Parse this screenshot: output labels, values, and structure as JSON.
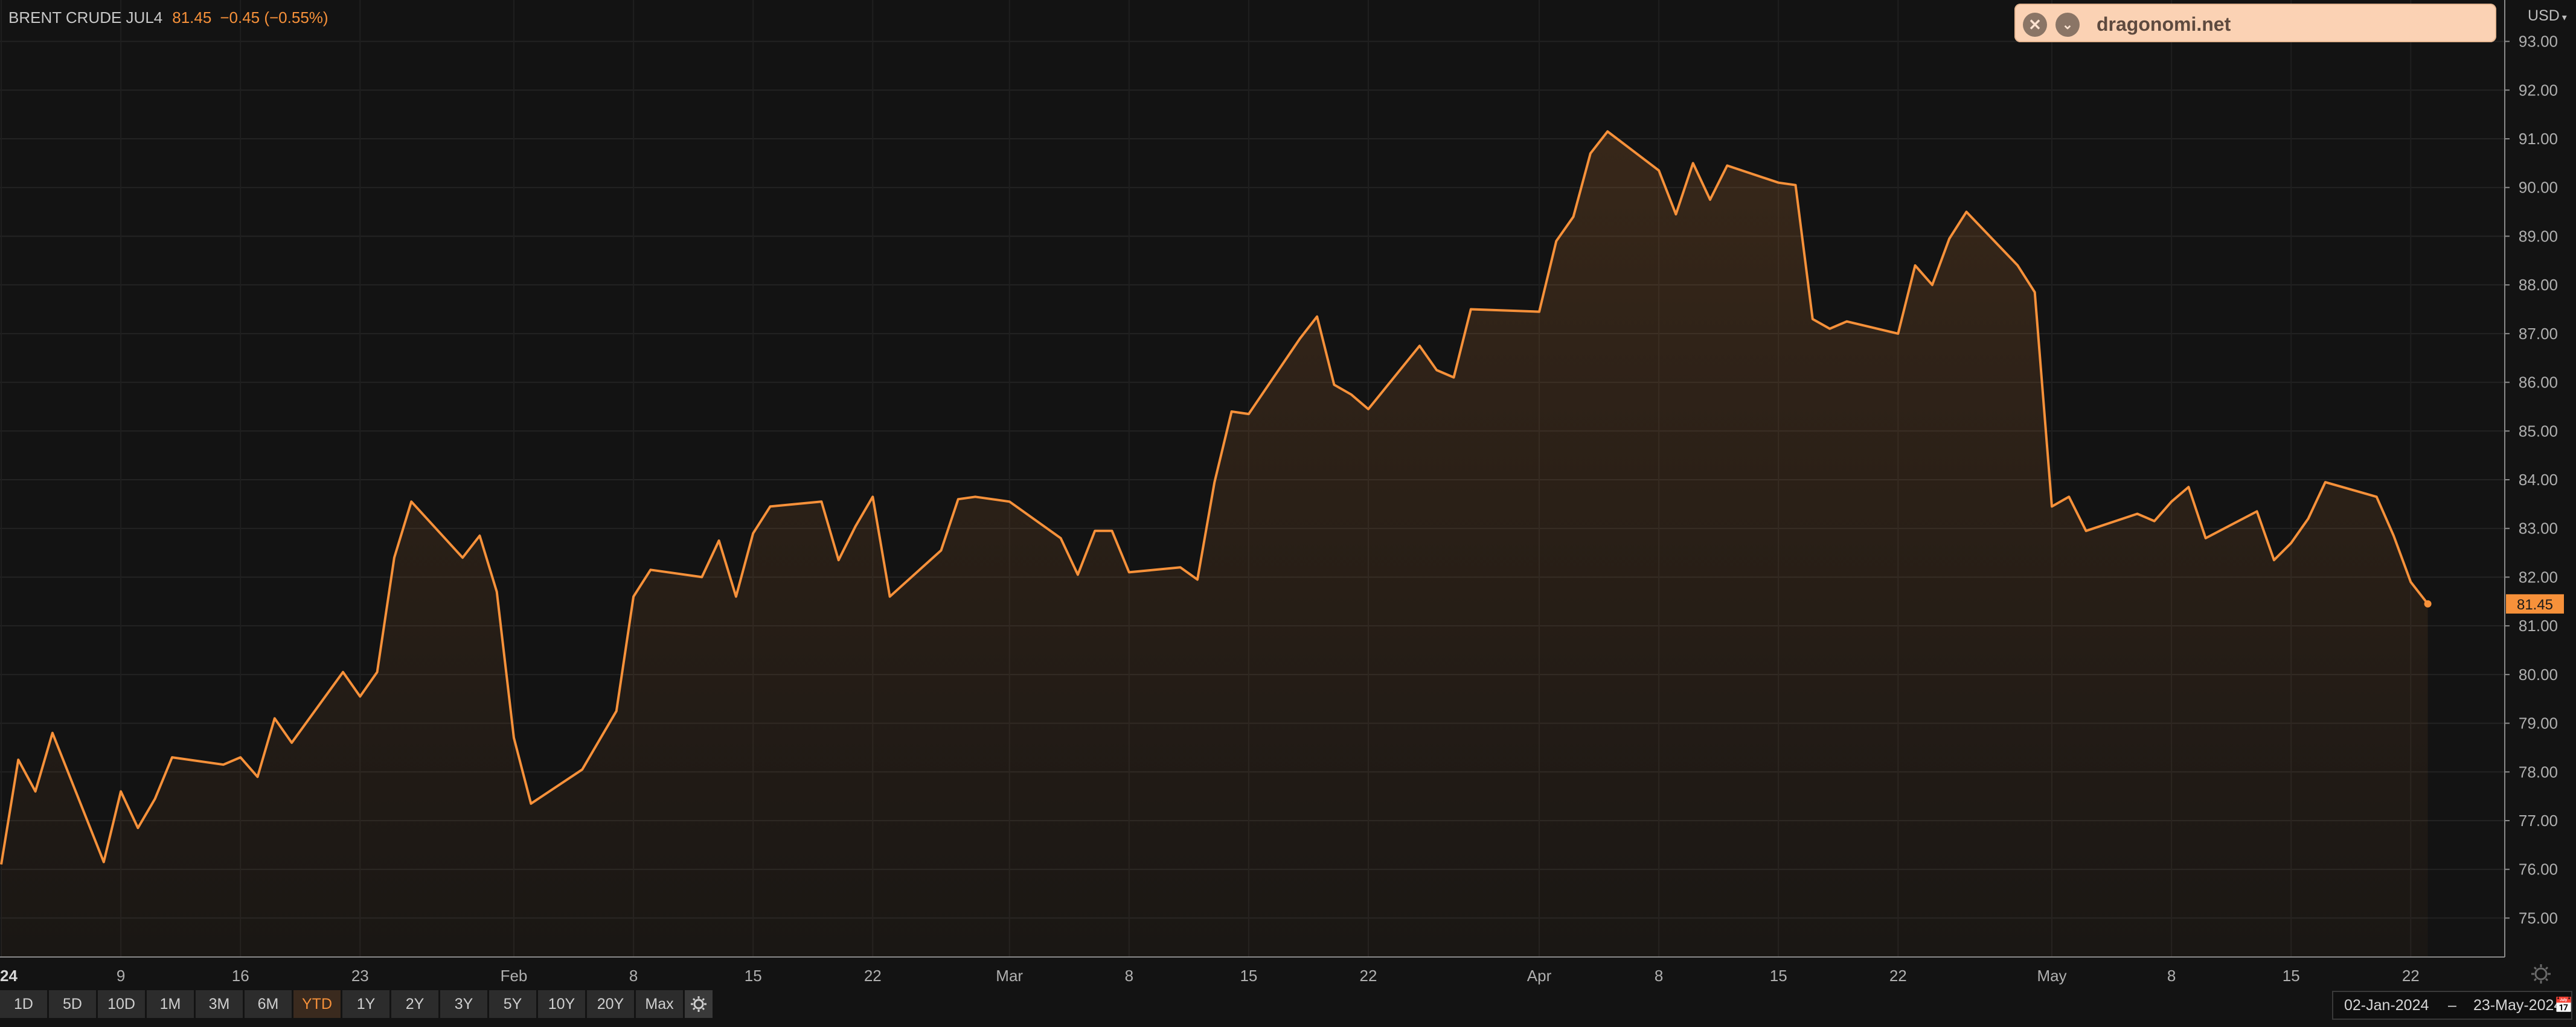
{
  "header": {
    "symbol": "BRENT CRUDE JUL4",
    "last": "81.45",
    "change": "−0.45 (−0.55%)"
  },
  "currency": {
    "label": "USD",
    "caret": "▾"
  },
  "overlay": {
    "site": "dragonomi.net",
    "close_glyph": "✕",
    "expand_glyph": "⌄"
  },
  "ranges": [
    "1D",
    "5D",
    "10D",
    "1M",
    "3M",
    "6M",
    "YTD",
    "1Y",
    "2Y",
    "3Y",
    "5Y",
    "10Y",
    "20Y",
    "Max"
  ],
  "active_range": "YTD",
  "date_range": {
    "from": "02-Jan-2024",
    "separator": "–",
    "to": "23-May-2024",
    "calendar_glyph": "📅"
  },
  "colors": {
    "accent": "#f7913a",
    "background": "#131313",
    "grid": "#222222",
    "axis_text": "#b0b0b0"
  },
  "chart_data": {
    "type": "area",
    "title": "BRENT CRUDE JUL4",
    "ylabel": "USD",
    "ylim": [
      74.2,
      93.85
    ],
    "y_ticks": [
      "93.00",
      "92.00",
      "91.00",
      "90.00",
      "89.00",
      "88.00",
      "87.00",
      "86.00",
      "85.00",
      "84.00",
      "83.00",
      "82.00",
      "81.00",
      "80.00",
      "79.00",
      "78.00",
      "77.00",
      "76.00",
      "75.00"
    ],
    "y_tick_values": [
      93,
      92,
      91,
      90,
      89,
      88,
      87,
      86,
      85,
      84,
      83,
      82,
      81,
      80,
      79,
      78,
      77,
      76,
      75
    ],
    "x_ticks": [
      {
        "label": "24",
        "date": "2024-01-02"
      },
      {
        "label": "9",
        "date": "2024-01-09"
      },
      {
        "label": "16",
        "date": "2024-01-16"
      },
      {
        "label": "23",
        "date": "2024-01-23"
      },
      {
        "label": "Feb",
        "date": "2024-02-01"
      },
      {
        "label": "8",
        "date": "2024-02-08"
      },
      {
        "label": "15",
        "date": "2024-02-15"
      },
      {
        "label": "22",
        "date": "2024-02-22"
      },
      {
        "label": "Mar",
        "date": "2024-03-01"
      },
      {
        "label": "8",
        "date": "2024-03-08"
      },
      {
        "label": "15",
        "date": "2024-03-15"
      },
      {
        "label": "22",
        "date": "2024-03-22"
      },
      {
        "label": "Apr",
        "date": "2024-04-01"
      },
      {
        "label": "8",
        "date": "2024-04-08"
      },
      {
        "label": "15",
        "date": "2024-04-15"
      },
      {
        "label": "22",
        "date": "2024-04-22"
      },
      {
        "label": "May",
        "date": "2024-05-01"
      },
      {
        "label": "8",
        "date": "2024-05-08"
      },
      {
        "label": "15",
        "date": "2024-05-15"
      },
      {
        "label": "22",
        "date": "2024-05-22"
      }
    ],
    "last_value_label": "81.45",
    "grid": true,
    "series": [
      {
        "values": [
          {
            "date": "2024-01-02",
            "value": 76.1
          },
          {
            "date": "2024-01-03",
            "value": 78.25
          },
          {
            "date": "2024-01-04",
            "value": 77.6
          },
          {
            "date": "2024-01-05",
            "value": 78.8
          },
          {
            "date": "2024-01-08",
            "value": 76.15
          },
          {
            "date": "2024-01-09",
            "value": 77.6
          },
          {
            "date": "2024-01-10",
            "value": 76.85
          },
          {
            "date": "2024-01-11",
            "value": 77.45
          },
          {
            "date": "2024-01-12",
            "value": 78.3
          },
          {
            "date": "2024-01-15",
            "value": 78.15
          },
          {
            "date": "2024-01-16",
            "value": 78.3
          },
          {
            "date": "2024-01-17",
            "value": 77.9
          },
          {
            "date": "2024-01-18",
            "value": 79.1
          },
          {
            "date": "2024-01-19",
            "value": 78.6
          },
          {
            "date": "2024-01-22",
            "value": 80.05
          },
          {
            "date": "2024-01-23",
            "value": 79.55
          },
          {
            "date": "2024-01-24",
            "value": 80.05
          },
          {
            "date": "2024-01-25",
            "value": 82.4
          },
          {
            "date": "2024-01-26",
            "value": 83.55
          },
          {
            "date": "2024-01-29",
            "value": 82.4
          },
          {
            "date": "2024-01-30",
            "value": 82.85
          },
          {
            "date": "2024-01-31",
            "value": 81.7
          },
          {
            "date": "2024-02-01",
            "value": 78.7
          },
          {
            "date": "2024-02-02",
            "value": 77.35
          },
          {
            "date": "2024-02-05",
            "value": 78.05
          },
          {
            "date": "2024-02-06",
            "value": 78.65
          },
          {
            "date": "2024-02-07",
            "value": 79.25
          },
          {
            "date": "2024-02-08",
            "value": 81.6
          },
          {
            "date": "2024-02-09",
            "value": 82.15
          },
          {
            "date": "2024-02-12",
            "value": 82.0
          },
          {
            "date": "2024-02-13",
            "value": 82.75
          },
          {
            "date": "2024-02-14",
            "value": 81.6
          },
          {
            "date": "2024-02-15",
            "value": 82.9
          },
          {
            "date": "2024-02-16",
            "value": 83.45
          },
          {
            "date": "2024-02-19",
            "value": 83.55
          },
          {
            "date": "2024-02-20",
            "value": 82.35
          },
          {
            "date": "2024-02-21",
            "value": 83.05
          },
          {
            "date": "2024-02-22",
            "value": 83.65
          },
          {
            "date": "2024-02-23",
            "value": 81.6
          },
          {
            "date": "2024-02-26",
            "value": 82.55
          },
          {
            "date": "2024-02-27",
            "value": 83.6
          },
          {
            "date": "2024-02-28",
            "value": 83.65
          },
          {
            "date": "2024-02-29",
            "value": 83.6
          },
          {
            "date": "2024-03-01",
            "value": 83.55
          },
          {
            "date": "2024-03-04",
            "value": 82.8
          },
          {
            "date": "2024-03-05",
            "value": 82.05
          },
          {
            "date": "2024-03-06",
            "value": 82.95
          },
          {
            "date": "2024-03-07",
            "value": 82.95
          },
          {
            "date": "2024-03-08",
            "value": 82.1
          },
          {
            "date": "2024-03-11",
            "value": 82.2
          },
          {
            "date": "2024-03-12",
            "value": 81.95
          },
          {
            "date": "2024-03-13",
            "value": 83.95
          },
          {
            "date": "2024-03-14",
            "value": 85.4
          },
          {
            "date": "2024-03-15",
            "value": 85.35
          },
          {
            "date": "2024-03-18",
            "value": 86.9
          },
          {
            "date": "2024-03-19",
            "value": 87.35
          },
          {
            "date": "2024-03-20",
            "value": 85.95
          },
          {
            "date": "2024-03-21",
            "value": 85.75
          },
          {
            "date": "2024-03-22",
            "value": 85.45
          },
          {
            "date": "2024-03-25",
            "value": 86.75
          },
          {
            "date": "2024-03-26",
            "value": 86.25
          },
          {
            "date": "2024-03-27",
            "value": 86.1
          },
          {
            "date": "2024-03-28",
            "value": 87.5
          },
          {
            "date": "2024-04-01",
            "value": 87.45
          },
          {
            "date": "2024-04-02",
            "value": 88.9
          },
          {
            "date": "2024-04-03",
            "value": 89.4
          },
          {
            "date": "2024-04-04",
            "value": 90.7
          },
          {
            "date": "2024-04-05",
            "value": 91.15
          },
          {
            "date": "2024-04-08",
            "value": 90.35
          },
          {
            "date": "2024-04-09",
            "value": 89.45
          },
          {
            "date": "2024-04-10",
            "value": 90.5
          },
          {
            "date": "2024-04-11",
            "value": 89.75
          },
          {
            "date": "2024-04-12",
            "value": 90.45
          },
          {
            "date": "2024-04-15",
            "value": 90.1
          },
          {
            "date": "2024-04-16",
            "value": 90.05
          },
          {
            "date": "2024-04-17",
            "value": 87.3
          },
          {
            "date": "2024-04-18",
            "value": 87.1
          },
          {
            "date": "2024-04-19",
            "value": 87.25
          },
          {
            "date": "2024-04-22",
            "value": 87.0
          },
          {
            "date": "2024-04-23",
            "value": 88.4
          },
          {
            "date": "2024-04-24",
            "value": 88.0
          },
          {
            "date": "2024-04-25",
            "value": 88.95
          },
          {
            "date": "2024-04-26",
            "value": 89.5
          },
          {
            "date": "2024-04-29",
            "value": 88.4
          },
          {
            "date": "2024-04-30",
            "value": 87.85
          },
          {
            "date": "2024-05-01",
            "value": 83.45
          },
          {
            "date": "2024-05-02",
            "value": 83.65
          },
          {
            "date": "2024-05-03",
            "value": 82.95
          },
          {
            "date": "2024-05-06",
            "value": 83.3
          },
          {
            "date": "2024-05-07",
            "value": 83.15
          },
          {
            "date": "2024-05-08",
            "value": 83.55
          },
          {
            "date": "2024-05-09",
            "value": 83.85
          },
          {
            "date": "2024-05-10",
            "value": 82.8
          },
          {
            "date": "2024-05-13",
            "value": 83.35
          },
          {
            "date": "2024-05-14",
            "value": 82.35
          },
          {
            "date": "2024-05-15",
            "value": 82.7
          },
          {
            "date": "2024-05-16",
            "value": 83.2
          },
          {
            "date": "2024-05-17",
            "value": 83.95
          },
          {
            "date": "2024-05-20",
            "value": 83.65
          },
          {
            "date": "2024-05-21",
            "value": 82.85
          },
          {
            "date": "2024-05-22",
            "value": 81.9
          },
          {
            "date": "2024-05-23",
            "value": 81.45
          }
        ]
      }
    ]
  }
}
